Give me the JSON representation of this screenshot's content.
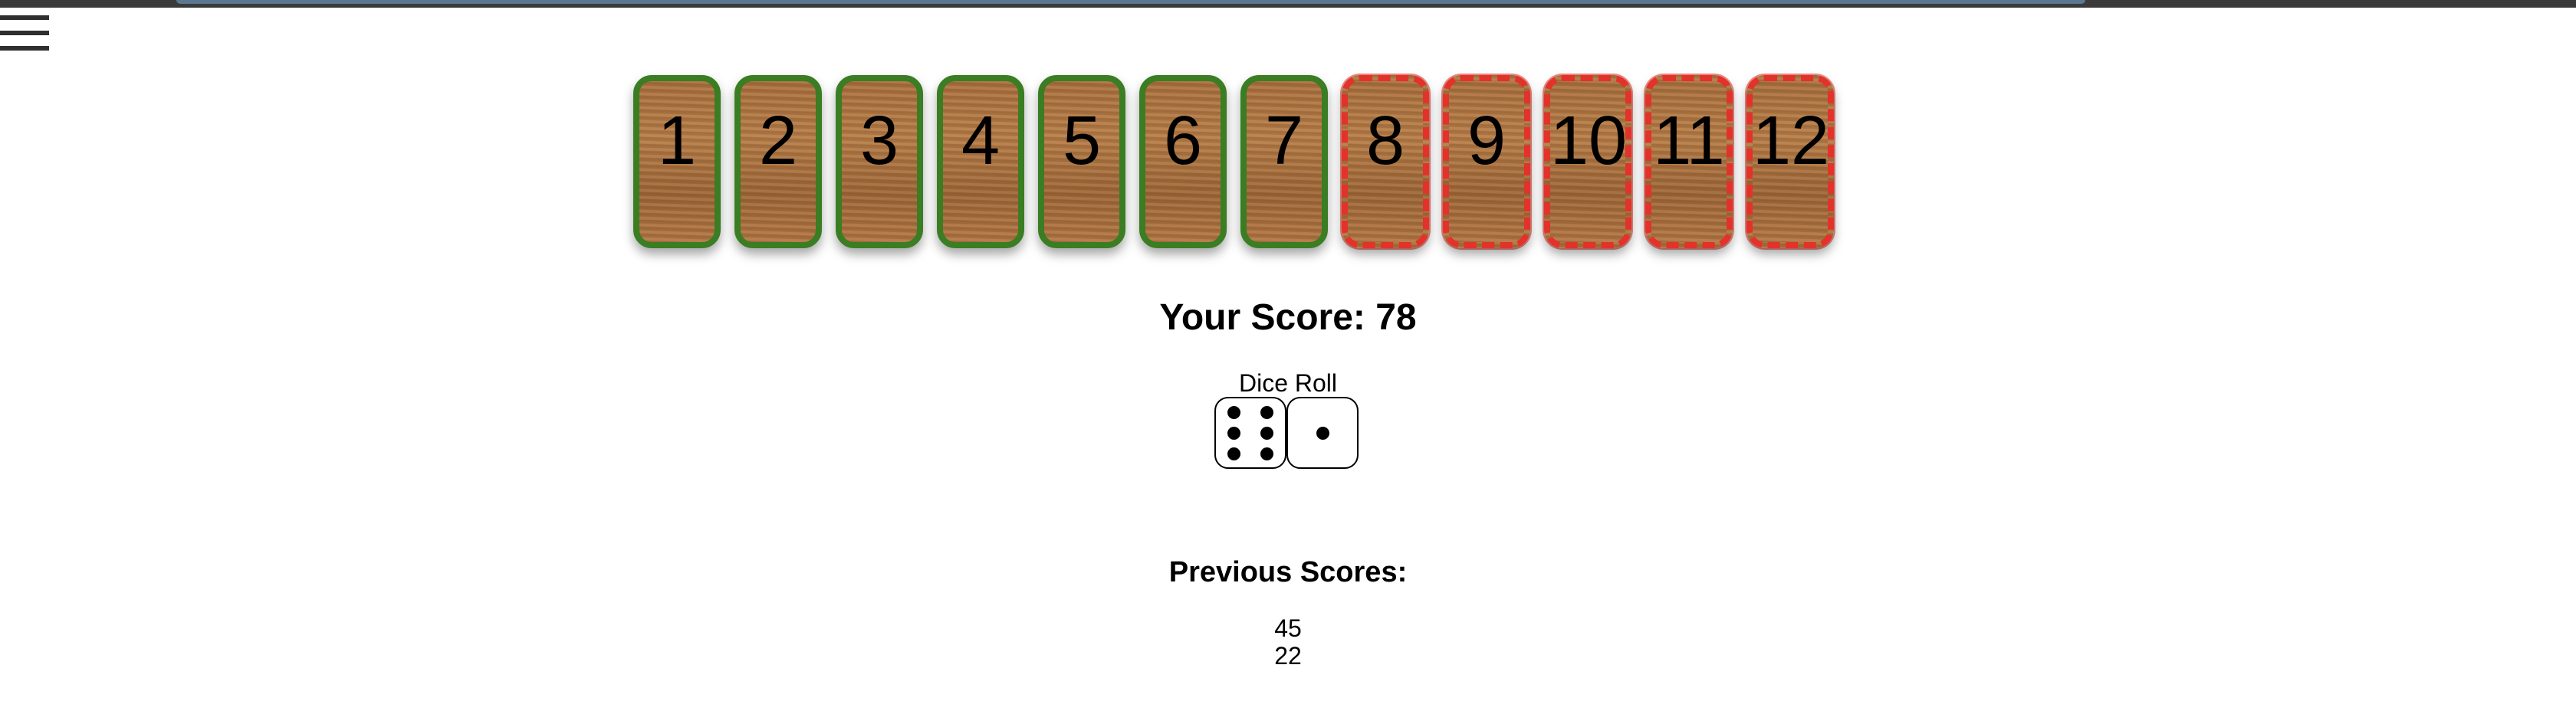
{
  "menu": {
    "icon": "hamburger-menu-icon"
  },
  "tiles": [
    {
      "label": "1",
      "state": "open"
    },
    {
      "label": "2",
      "state": "open"
    },
    {
      "label": "3",
      "state": "open"
    },
    {
      "label": "4",
      "state": "open"
    },
    {
      "label": "5",
      "state": "open"
    },
    {
      "label": "6",
      "state": "open"
    },
    {
      "label": "7",
      "state": "open"
    },
    {
      "label": "8",
      "state": "shut"
    },
    {
      "label": "9",
      "state": "shut"
    },
    {
      "label": "10",
      "state": "shut"
    },
    {
      "label": "11",
      "state": "shut"
    },
    {
      "label": "12",
      "state": "shut"
    }
  ],
  "score": {
    "text": "Your Score: 78"
  },
  "dice": {
    "label": "Dice Roll",
    "values": [
      6,
      1
    ]
  },
  "previous": {
    "title": "Previous Scores:",
    "scores": [
      "45",
      "22"
    ]
  },
  "colors": {
    "open_border": "#3a7d22",
    "shut_border": "#e2322a",
    "wood": "#a8703f"
  }
}
